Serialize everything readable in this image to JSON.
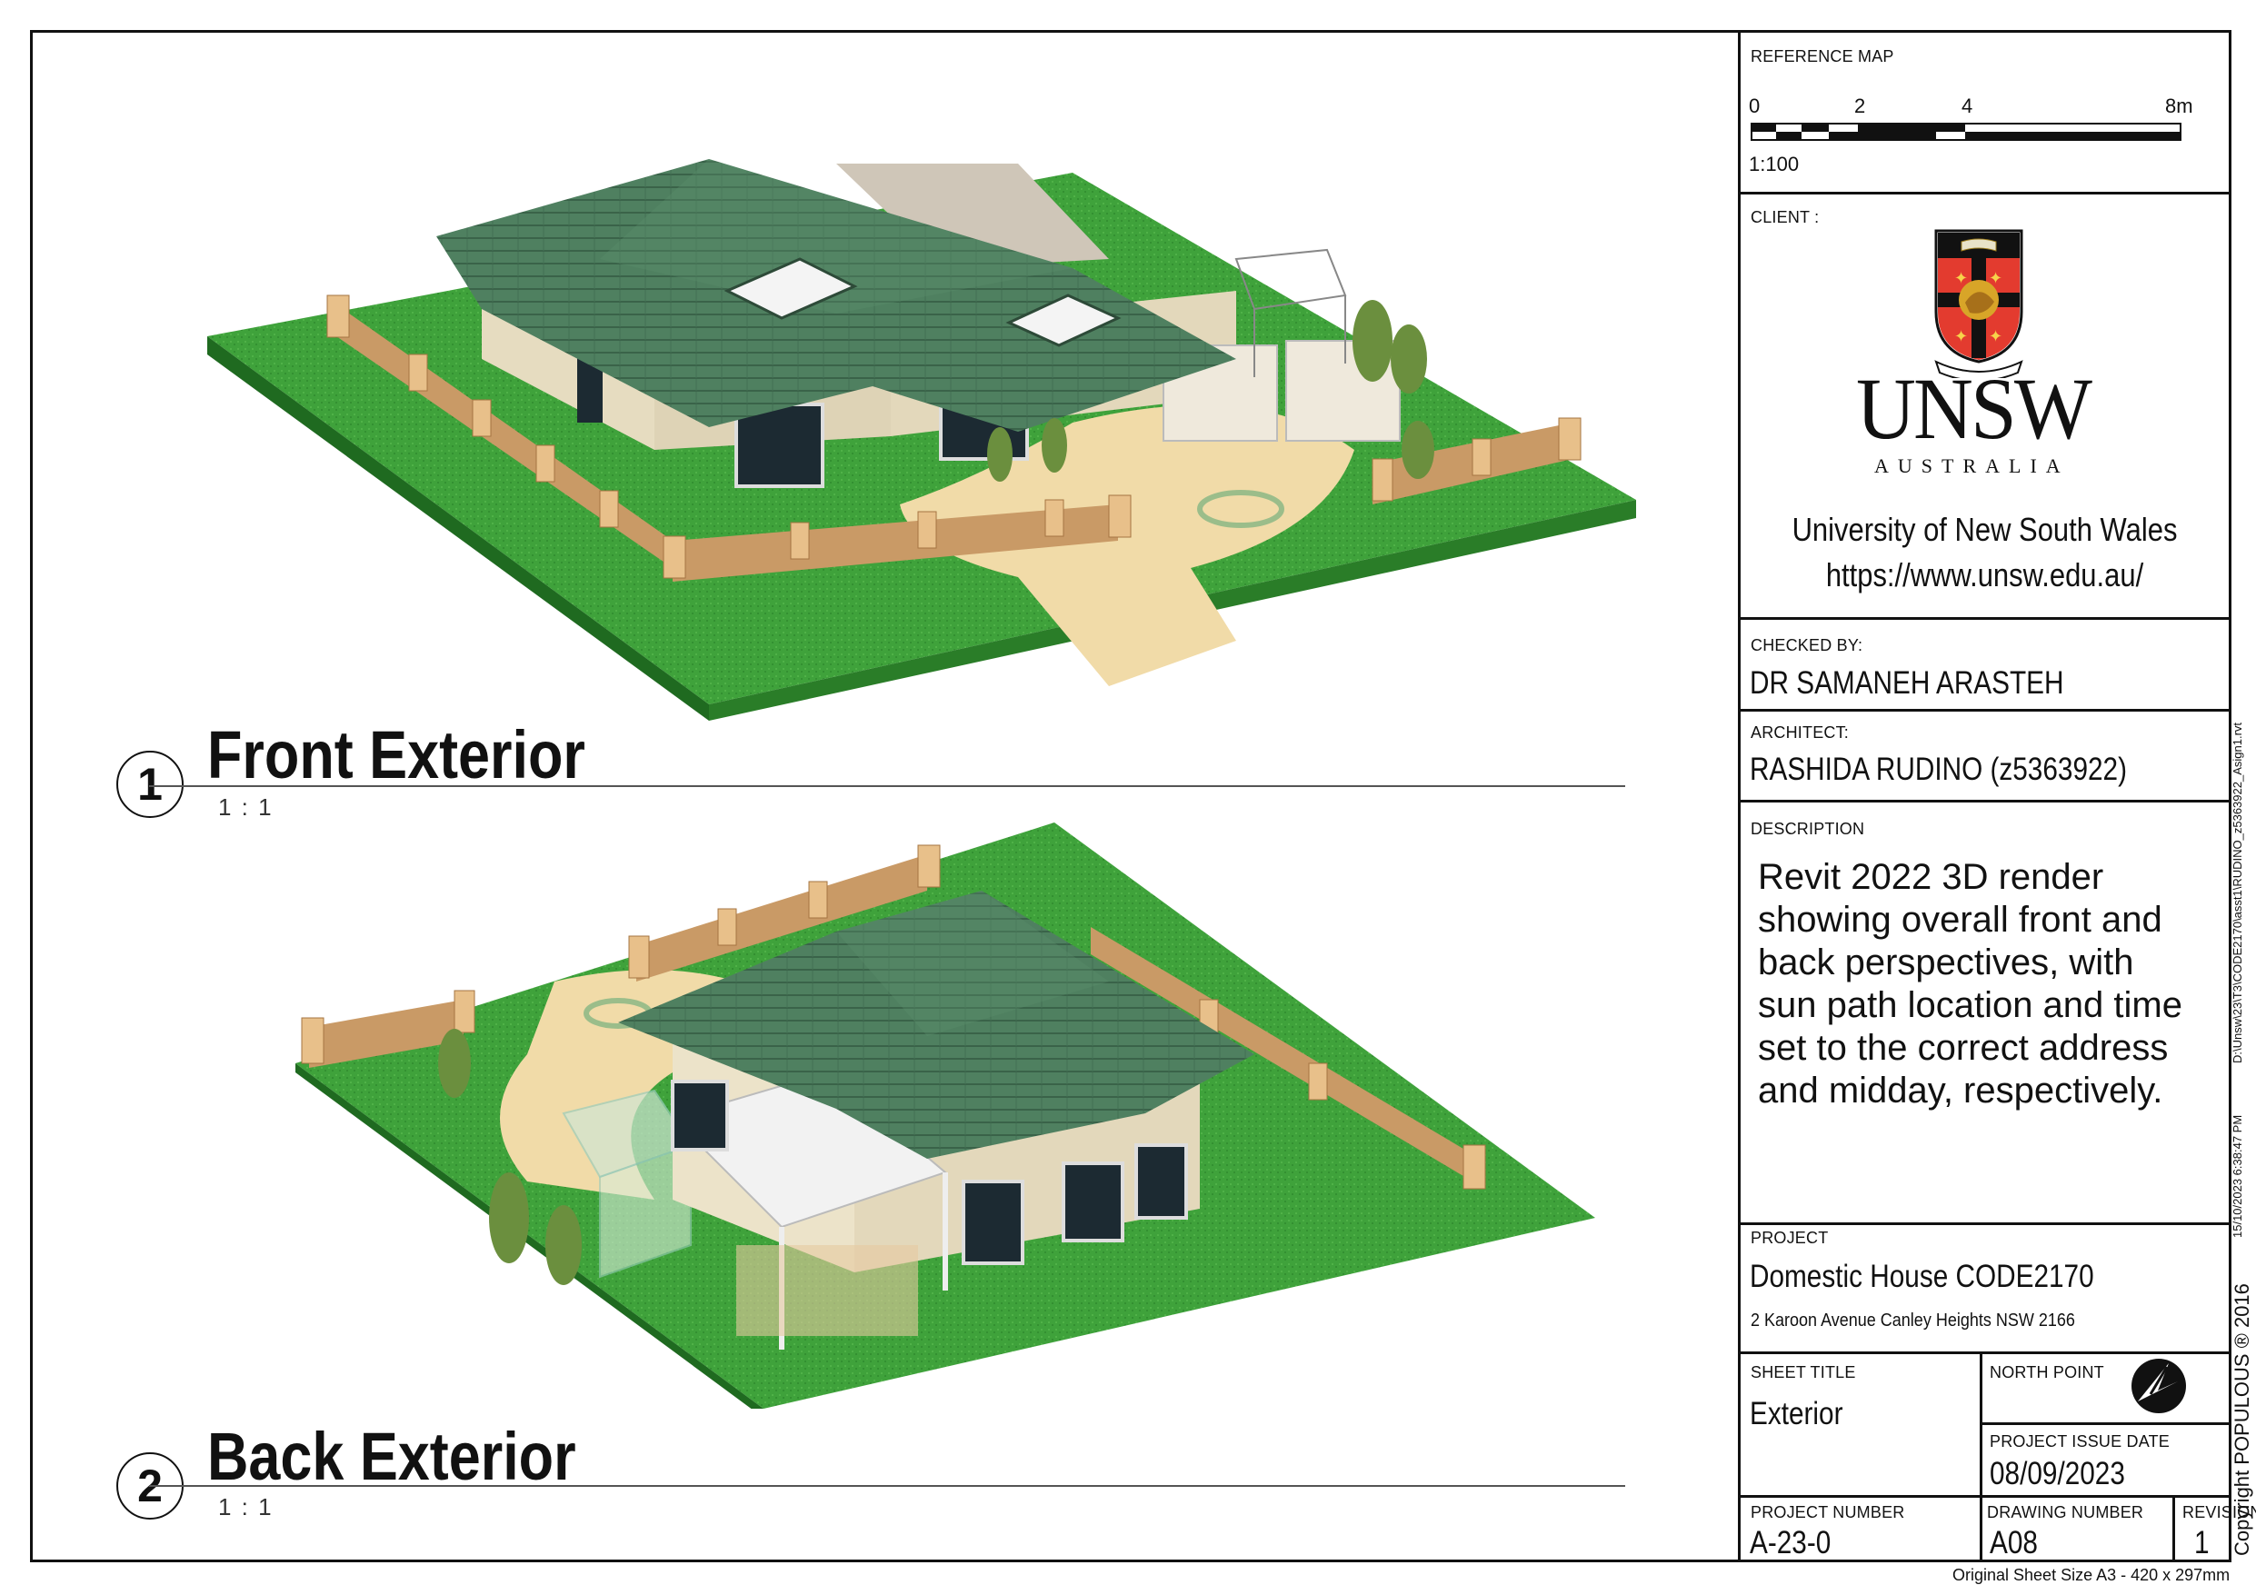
{
  "views": [
    {
      "number": "1",
      "title": "Front Exterior",
      "scale": "1 : 1"
    },
    {
      "number": "2",
      "title": "Back Exterior",
      "scale": "1 : 1"
    }
  ],
  "reference_map": {
    "label": "REFERENCE MAP",
    "ticks": [
      "0",
      "2",
      "4",
      "8m"
    ],
    "ratio": "1:100"
  },
  "client": {
    "label": "CLIENT :",
    "crest_motto": "MANU ET MENTE",
    "crest_book": "SCIENTIA",
    "logo_main": "UNSW",
    "logo_sub": "AUSTRALIA",
    "name": "University of New South Wales",
    "url": "https://www.unsw.edu.au/"
  },
  "checked_by": {
    "label": "CHECKED BY:",
    "value": "DR SAMANEH ARASTEH"
  },
  "architect": {
    "label": "ARCHITECT:",
    "value": "RASHIDA RUDINO (z5363922)"
  },
  "description": {
    "label": "DESCRIPTION",
    "lines": [
      "Revit 2022 3D render",
      "showing overall front and",
      "back perspectives, with",
      "sun path location and time",
      "set to the correct address",
      "and midday, respectively."
    ]
  },
  "project": {
    "label": "PROJECT",
    "value": "Domestic House CODE2170",
    "address": "2 Karoon Avenue Canley Heights NSW 2166"
  },
  "sheet_title": {
    "label": "SHEET TITLE",
    "value": "Exterior"
  },
  "north_point": {
    "label": "NORTH POINT"
  },
  "issue_date": {
    "label": "PROJECT ISSUE DATE",
    "value": "08/09/2023"
  },
  "project_number": {
    "label": "PROJECT NUMBER",
    "value": "A-23-0"
  },
  "drawing_number": {
    "label": "DRAWING NUMBER",
    "value": "A08"
  },
  "revision": {
    "label": "REVISION",
    "value": "1"
  },
  "side_file": "D:\\Unsw\\23\\T3\\CODE2170\\asst1\\RUDINO_z5363922_Asign1.rvt",
  "side_date": "15/10/2023 6:38:47 PM",
  "copyright": "Copyright POPULOUS ® 2016",
  "sheet_size": "Original Sheet Size A3 - 420 x 297mm",
  "colors": {
    "grass": "#3f9e3a",
    "roof": "#4e7f5e",
    "wall": "#e6dcc0",
    "fence": "#c99a66",
    "path": "#f1dba8"
  }
}
